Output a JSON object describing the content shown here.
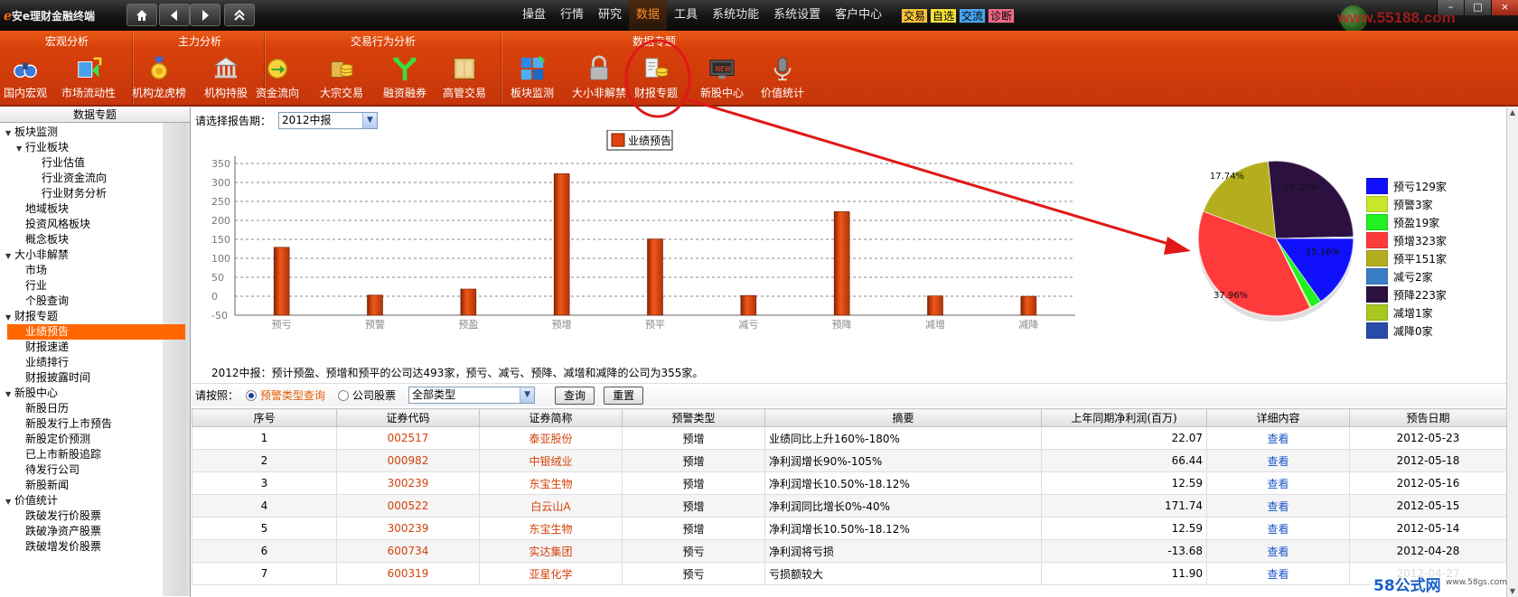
{
  "app": {
    "title_prefix": "e",
    "title": "安e理财金融终端",
    "menu": [
      "操盘",
      "行情",
      "研究",
      "数据",
      "工具",
      "系统功能",
      "系统设置",
      "客户中心"
    ],
    "active_menu": "数据",
    "quick_buttons": [
      {
        "label": "交易",
        "color": "#f5c23a"
      },
      {
        "label": "自选",
        "color": "#f5e23a"
      },
      {
        "label": "交流",
        "color": "#4aa6f0"
      },
      {
        "label": "诊断",
        "color": "#f06a8a"
      }
    ],
    "window_controls": [
      "–",
      "□",
      "×"
    ],
    "watermark": "www.55188.com"
  },
  "ribbon": {
    "groups": [
      {
        "label": "宏观分析"
      },
      {
        "label": "主力分析"
      },
      {
        "label": "交易行为分析"
      },
      {
        "label": "数据专题"
      }
    ],
    "buttons": [
      {
        "label": "国内宏观",
        "icon": "binoculars-icon"
      },
      {
        "label": "市场流动性",
        "icon": "building-arrows-icon"
      },
      {
        "label": "机构龙虎榜",
        "icon": "medal-icon"
      },
      {
        "label": "机构持股",
        "icon": "bank-icon"
      },
      {
        "label": "资金流向",
        "icon": "coin-arrow-icon"
      },
      {
        "label": "大宗交易",
        "icon": "coin-stack-icon"
      },
      {
        "label": "融资融券",
        "icon": "split-arrow-icon"
      },
      {
        "label": "高管交易",
        "icon": "cabinet-icon"
      },
      {
        "label": "板块监测",
        "icon": "blocks-icon"
      },
      {
        "label": "大小非解禁",
        "icon": "padlock-icon"
      },
      {
        "label": "财报专题",
        "icon": "report-coins-icon"
      },
      {
        "label": "新股中心",
        "icon": "new-monitor-icon"
      },
      {
        "label": "价值统计",
        "icon": "microphone-icon"
      }
    ]
  },
  "left_panel": {
    "header": "数据专题",
    "tree": [
      {
        "label": "板块监测",
        "level": 0,
        "expanded": true
      },
      {
        "label": "行业板块",
        "level": 1,
        "expanded": true
      },
      {
        "label": "行业估值",
        "level": 2
      },
      {
        "label": "行业资金流向",
        "level": 2
      },
      {
        "label": "行业财务分析",
        "level": 2
      },
      {
        "label": "地域板块",
        "level": 1
      },
      {
        "label": "投资风格板块",
        "level": 1
      },
      {
        "label": "概念板块",
        "level": 1
      },
      {
        "label": "大小非解禁",
        "level": 0,
        "expanded": true
      },
      {
        "label": "市场",
        "level": 1
      },
      {
        "label": "行业",
        "level": 1
      },
      {
        "label": "个股查询",
        "level": 1
      },
      {
        "label": "财报专题",
        "level": 0,
        "expanded": true
      },
      {
        "label": "业绩预告",
        "level": 1,
        "selected": true
      },
      {
        "label": "财报速递",
        "level": 1
      },
      {
        "label": "业绩排行",
        "level": 1
      },
      {
        "label": "财报披露时间",
        "level": 1
      },
      {
        "label": "新股中心",
        "level": 0,
        "expanded": true
      },
      {
        "label": "新股日历",
        "level": 1
      },
      {
        "label": "新股发行上市预告",
        "level": 1
      },
      {
        "label": "新股定价预测",
        "level": 1
      },
      {
        "label": "已上市新股追踪",
        "level": 1
      },
      {
        "label": "待发行公司",
        "level": 1
      },
      {
        "label": "新股新闻",
        "level": 1
      },
      {
        "label": "价值统计",
        "level": 0,
        "expanded": true
      },
      {
        "label": "跌破发行价股票",
        "level": 1
      },
      {
        "label": "跌破净资产股票",
        "level": 1
      },
      {
        "label": "跌破增发价股票",
        "level": 1
      }
    ]
  },
  "content": {
    "period_label": "请选择报告期：",
    "period_value": "2012中报",
    "summary": "2012中报：预计预盈、预增和预平的公司达493家，预亏、减亏、预降、减增和减降的公司为355家。",
    "query": {
      "label": "请按照：",
      "radio_type": "预警类型查询",
      "radio_stock": "公司股票",
      "type_value": "全部类型",
      "query_button": "查询",
      "reset_button": "重置"
    },
    "table": {
      "headers": [
        "序号",
        "证券代码",
        "证券简称",
        "预警类型",
        "摘要",
        "上年同期净利润(百万)",
        "详细内容",
        "预告日期"
      ],
      "rows": [
        [
          "1",
          "002517",
          "泰亚股份",
          "预增",
          "业绩同比上升160%-180%",
          "22.07",
          "查看",
          "2012-05-23"
        ],
        [
          "2",
          "000982",
          "中银绒业",
          "预增",
          "净利润增长90%-105%",
          "66.44",
          "查看",
          "2012-05-18"
        ],
        [
          "3",
          "300239",
          "东宝生物",
          "预增",
          "净利润增长10.50%-18.12%",
          "12.59",
          "查看",
          "2012-05-16"
        ],
        [
          "4",
          "000522",
          "白云山A",
          "预增",
          "净利润同比增长0%-40%",
          "171.74",
          "查看",
          "2012-05-15"
        ],
        [
          "5",
          "300239",
          "东宝生物",
          "预增",
          "净利润增长10.50%-18.12%",
          "12.59",
          "查看",
          "2012-05-14"
        ],
        [
          "6",
          "600734",
          "实达集团",
          "预亏",
          "净利润将亏损",
          "-13.68",
          "查看",
          "2012-04-28"
        ],
        [
          "7",
          "600319",
          "亚星化学",
          "预亏",
          "亏损额较大",
          "11.90",
          "查看",
          "2012-04-27"
        ]
      ]
    }
  },
  "chart_data": [
    {
      "type": "bar",
      "legend": "业绩预告",
      "categories": [
        "预亏",
        "预警",
        "预盈",
        "预增",
        "预平",
        "减亏",
        "预降",
        "减增",
        "减降"
      ],
      "values": [
        129,
        3,
        19,
        323,
        151,
        2,
        223,
        1,
        0
      ],
      "ylim": [
        -50,
        350
      ],
      "yticks": [
        -50,
        0,
        50,
        100,
        150,
        200,
        250,
        300,
        350
      ],
      "grid": true,
      "color": "#e0440e"
    },
    {
      "type": "pie",
      "slices": [
        {
          "label": "预亏129家",
          "value": 129,
          "color": "#1010ff"
        },
        {
          "label": "预警3家",
          "value": 3,
          "color": "#c8e62a"
        },
        {
          "label": "预盈19家",
          "value": 19,
          "color": "#22f022"
        },
        {
          "label": "预增323家",
          "value": 323,
          "color": "#ff3a3a"
        },
        {
          "label": "预平151家",
          "value": 151,
          "color": "#b4ae1e"
        },
        {
          "label": "减亏2家",
          "value": 2,
          "color": "#3a7ec8"
        },
        {
          "label": "预降223家",
          "value": 223,
          "color": "#2c1040"
        },
        {
          "label": "减增1家",
          "value": 1,
          "color": "#a8c81e"
        },
        {
          "label": "减降0家",
          "value": 0,
          "color": "#2a4aa8"
        }
      ],
      "percent_labels": [
        "15.16%",
        "37.96%",
        "17.74%",
        "26.20%"
      ]
    }
  ],
  "corner_watermark": {
    "big": "58公式网",
    "small": "www.58gs.com"
  }
}
